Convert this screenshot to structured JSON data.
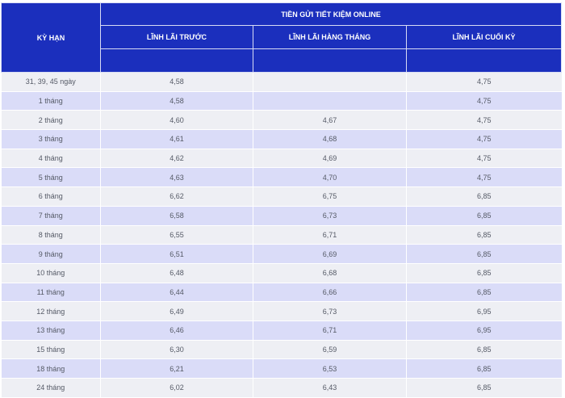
{
  "header": {
    "term": "KỲ HẠN",
    "group": "TIỀN GỬI TIẾT KIỆM ONLINE",
    "columns": [
      "LĨNH LÃI TRƯỚC",
      "LĨNH LÃI HÀNG THÁNG",
      "LĨNH LÃI CUỐI KỲ"
    ]
  },
  "rows": [
    {
      "term": "31, 39, 45 ngày",
      "prepaid": "4,58",
      "monthly": "",
      "end": "4,75"
    },
    {
      "term": "1 tháng",
      "prepaid": "4,58",
      "monthly": "",
      "end": "4,75"
    },
    {
      "term": "2 tháng",
      "prepaid": "4,60",
      "monthly": "4,67",
      "end": "4,75"
    },
    {
      "term": "3 tháng",
      "prepaid": "4,61",
      "monthly": "4,68",
      "end": "4,75"
    },
    {
      "term": "4 tháng",
      "prepaid": "4,62",
      "monthly": "4,69",
      "end": "4,75"
    },
    {
      "term": "5 tháng",
      "prepaid": "4,63",
      "monthly": "4,70",
      "end": "4,75"
    },
    {
      "term": "6 tháng",
      "prepaid": "6,62",
      "monthly": "6,75",
      "end": "6,85"
    },
    {
      "term": "7 tháng",
      "prepaid": "6,58",
      "monthly": "6,73",
      "end": "6,85"
    },
    {
      "term": "8 tháng",
      "prepaid": "6,55",
      "monthly": "6,71",
      "end": "6,85"
    },
    {
      "term": "9 tháng",
      "prepaid": "6,51",
      "monthly": "6,69",
      "end": "6,85"
    },
    {
      "term": "10 tháng",
      "prepaid": "6,48",
      "monthly": "6,68",
      "end": "6,85"
    },
    {
      "term": "11 tháng",
      "prepaid": "6,44",
      "monthly": "6,66",
      "end": "6,85"
    },
    {
      "term": "12 tháng",
      "prepaid": "6,49",
      "monthly": "6,73",
      "end": "6,95"
    },
    {
      "term": "13 tháng",
      "prepaid": "6,46",
      "monthly": "6,71",
      "end": "6,95"
    },
    {
      "term": "15 tháng",
      "prepaid": "6,30",
      "monthly": "6,59",
      "end": "6,85"
    },
    {
      "term": "18 tháng",
      "prepaid": "6,21",
      "monthly": "6,53",
      "end": "6,85"
    },
    {
      "term": "24 tháng",
      "prepaid": "6,02",
      "monthly": "6,43",
      "end": "6,85"
    }
  ],
  "colors": {
    "header_bg": "#1b2fbd",
    "row_light": "#eeeff4",
    "row_dark": "#dadcf8",
    "text": "#555a66"
  }
}
